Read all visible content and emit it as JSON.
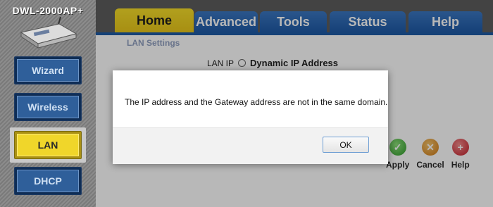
{
  "device": {
    "model": "DWL-2000AP+"
  },
  "sidebar": {
    "items": [
      {
        "label": "Wizard"
      },
      {
        "label": "Wireless"
      },
      {
        "label": "LAN",
        "active": true
      },
      {
        "label": "DHCP"
      }
    ]
  },
  "tabs": [
    {
      "label": "Home",
      "active": true
    },
    {
      "label": "Advanced"
    },
    {
      "label": "Tools"
    },
    {
      "label": "Status"
    },
    {
      "label": "Help"
    }
  ],
  "main": {
    "section_title": "LAN Settings",
    "lan_ip_label": "LAN IP",
    "lan_ip_option": "Dynamic IP Address"
  },
  "actions": [
    {
      "label": "Apply",
      "icon": "check-icon",
      "color": "#2e9a2a"
    },
    {
      "label": "Cancel",
      "icon": "x-icon",
      "color": "#cf7a17"
    },
    {
      "label": "Help",
      "icon": "plus-icon",
      "color": "#c21e2a"
    }
  ],
  "dialog": {
    "message": "The IP address and the Gateway address are not in the same domain.",
    "ok_label": "OK"
  },
  "colors": {
    "tab_active": "#f0d62a",
    "tab_inactive": "#1e5aa6",
    "nav_button": "#2f5f9a"
  }
}
